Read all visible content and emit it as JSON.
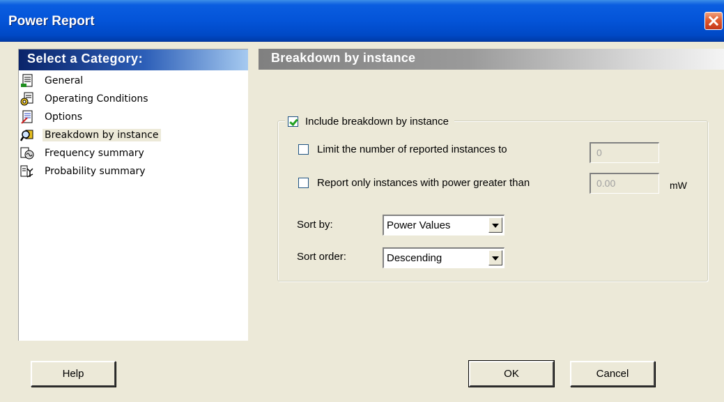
{
  "window": {
    "title": "Power Report",
    "close_label": "×"
  },
  "sidebar": {
    "header": "Select a Category:",
    "items": [
      {
        "label": "General",
        "icon": "general-icon"
      },
      {
        "label": "Operating Conditions",
        "icon": "operating-conditions-icon"
      },
      {
        "label": "Options",
        "icon": "options-icon"
      },
      {
        "label": "Breakdown by instance",
        "icon": "breakdown-icon",
        "selected": true
      },
      {
        "label": "Frequency summary",
        "icon": "frequency-icon"
      },
      {
        "label": "Probability summary",
        "icon": "probability-icon"
      }
    ]
  },
  "panel": {
    "header": "Breakdown by instance",
    "include_label": "Include breakdown by instance",
    "include_checked": true,
    "limit_label": "Limit the number of reported instances to",
    "limit_checked": false,
    "limit_value": "0",
    "power_label": "Report only instances with power greater than",
    "power_checked": false,
    "power_value": "0.00",
    "power_unit": "mW",
    "sort_by_label": "Sort by:",
    "sort_by_value": "Power Values",
    "sort_order_label": "Sort order:",
    "sort_order_value": "Descending"
  },
  "buttons": {
    "help": "Help",
    "ok": "OK",
    "cancel": "Cancel"
  },
  "colors": {
    "titlebar": "#0454d8",
    "dialog_bg": "#ece9d8",
    "sidebar_header": "#0a246a",
    "check_mark": "#21a121"
  }
}
